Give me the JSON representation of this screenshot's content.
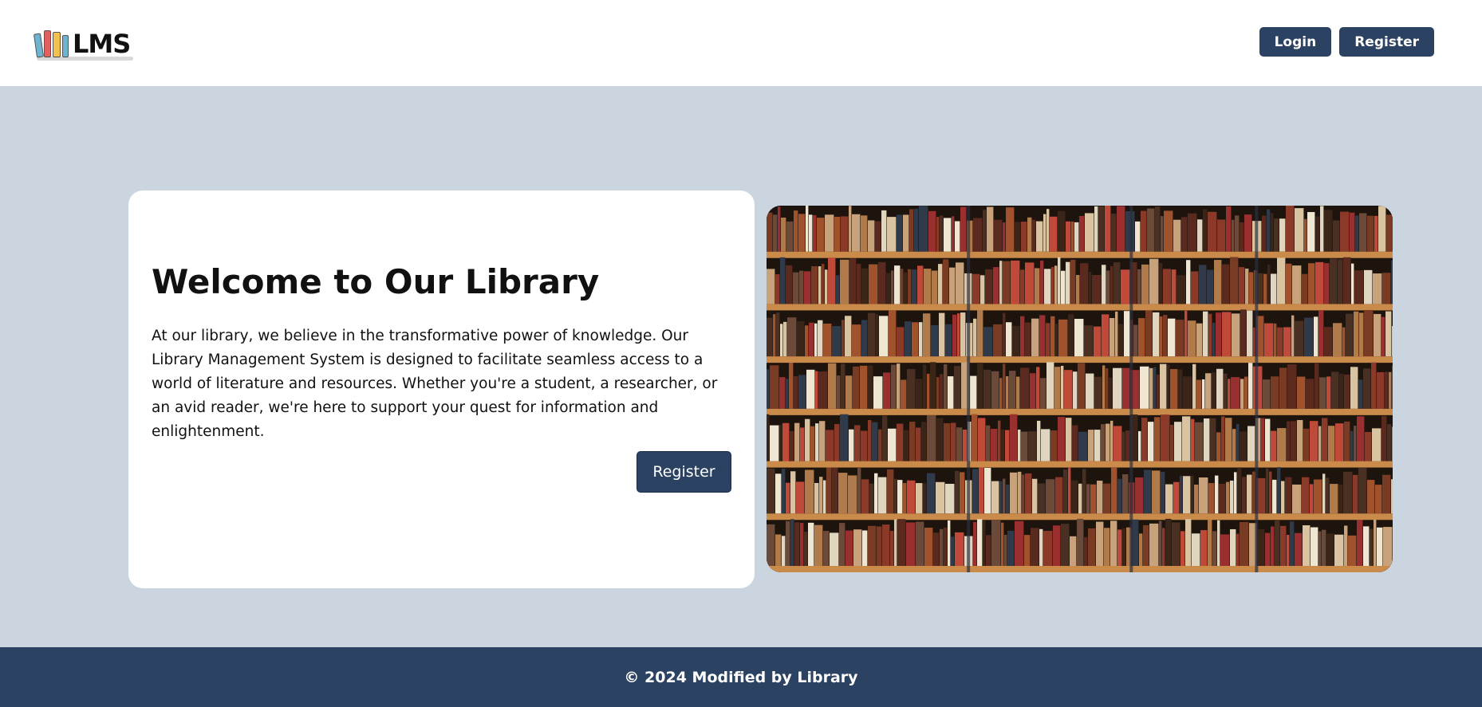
{
  "header": {
    "logo_text": "LMS",
    "nav": {
      "login_label": "Login",
      "register_label": "Register"
    }
  },
  "hero": {
    "title": "Welcome to Our Library",
    "description": "At our library, we believe in the transformative power of knowledge. Our Library Management System is designed to facilitate seamless access to a world of literature and resources. Whether you're a student, a researcher, or an avid reader, we're here to support your quest for information and enlightenment.",
    "cta_label": "Register",
    "image_icon": "bookshelf-photo"
  },
  "footer": {
    "text": "© 2024 Modified by Library"
  },
  "colors": {
    "page_bg": "#cbd5e0",
    "primary": "#2c4262",
    "card_bg": "#ffffff"
  }
}
